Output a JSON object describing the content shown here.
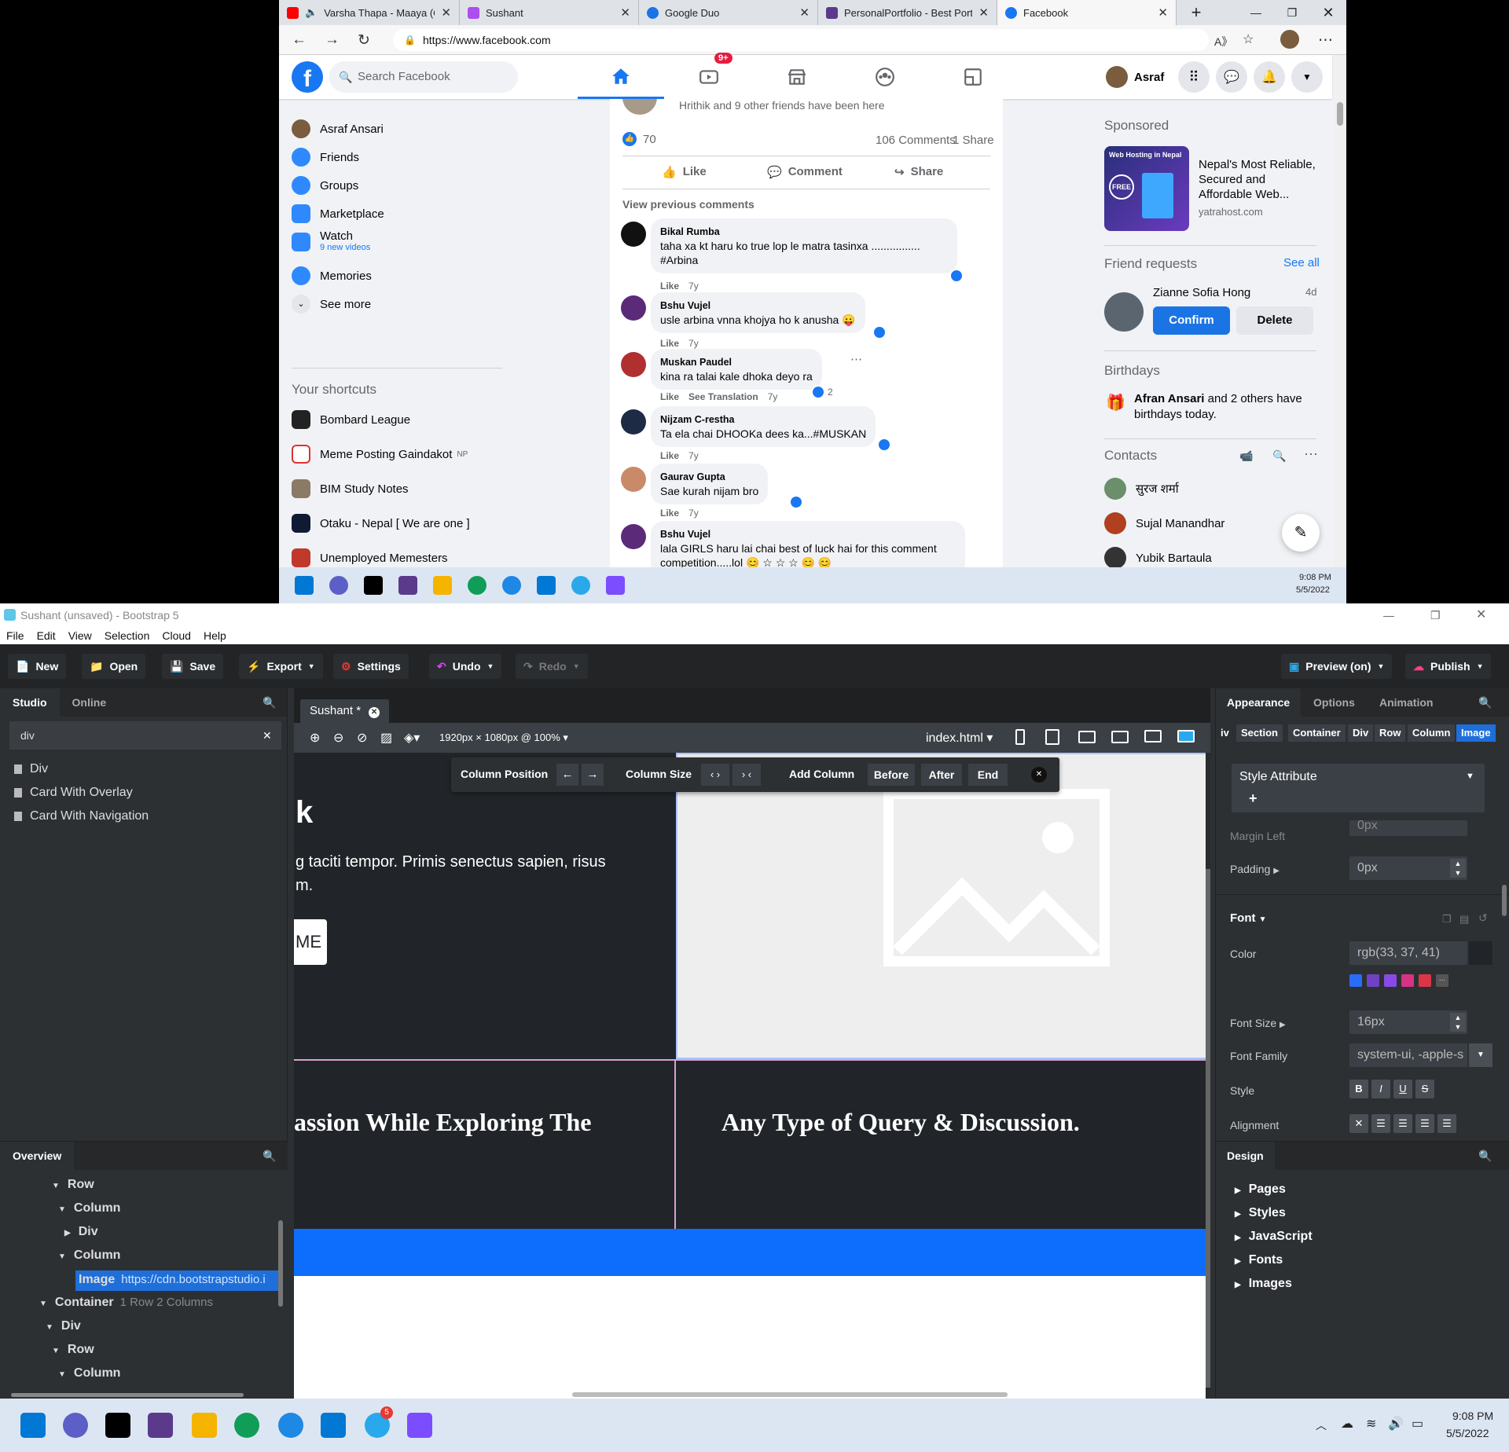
{
  "browser": {
    "tabs": [
      {
        "title": "Varsha Thapa - Maaya (O",
        "color": "#ff0000"
      },
      {
        "title": "Sushant",
        "color": "#ad4ef0"
      },
      {
        "title": "Google Duo",
        "color": "#1a73e8"
      },
      {
        "title": "PersonalPortfolio - Best Portfo",
        "color": "#5b3a8c"
      },
      {
        "title": "Facebook",
        "color": "#1877f2"
      }
    ],
    "url": "https://www.facebook.com",
    "taskbar_time": "9:08 PM",
    "taskbar_date": "5/5/2022"
  },
  "facebook": {
    "search_placeholder": "Search Facebook",
    "watch_badge": "9+",
    "user_name": "Asraf",
    "left_menu": [
      {
        "label": "Asraf Ansari",
        "color": "#7a5c3e"
      },
      {
        "label": "Friends",
        "color": "#2e89ff"
      },
      {
        "label": "Groups",
        "color": "#2e89ff"
      },
      {
        "label": "Marketplace",
        "color": "#2e89ff"
      },
      {
        "label": "Watch",
        "color": "#2e89ff"
      },
      {
        "label": "Memories",
        "color": "#2e89ff"
      },
      {
        "label": "See more",
        "color": "#e4e6eb"
      }
    ],
    "watch_sub": "9 new videos",
    "shortcuts_title": "Your shortcuts",
    "shortcuts": [
      {
        "label": "Bombard League",
        "suffix": "",
        "color": "#222"
      },
      {
        "label": "Meme Posting Gaindakot",
        "suffix": "NP",
        "color": "#d33"
      },
      {
        "label": "BIM Study Notes",
        "suffix": "",
        "color": "#8a7a66"
      },
      {
        "label": "Otaku - Nepal [ We are one ]",
        "suffix": "",
        "color": "#111a33"
      },
      {
        "label": "Unemployed Memesters",
        "suffix": "",
        "color": "#c0392b"
      }
    ],
    "post": {
      "friends_text": "Hrithik and 9 other friends have been here",
      "reactions": "70",
      "comments_count": "106 Comments",
      "shares": "1 Share",
      "actions": [
        "Like",
        "Comment",
        "Share"
      ],
      "view_previous": "View previous comments"
    },
    "comments": [
      {
        "name": "Bikal Rumba",
        "text": "taha xa kt haru ko true lop le matra tasinxa ................",
        "text2": "#Arbina",
        "like": "Like",
        "extra": "",
        "time": "7y",
        "count": "",
        "color": "#111"
      },
      {
        "name": "Bshu Vujel",
        "text": "usle arbina vnna khojya ho k anusha 😛",
        "text2": "",
        "like": "Like",
        "extra": "",
        "time": "7y",
        "count": "",
        "color": "#5b2b7a"
      },
      {
        "name": "Muskan Paudel",
        "text": "kina ra talai kale dhoka deyo ra",
        "text2": "",
        "like": "Like",
        "extra": "See Translation",
        "time": "7y",
        "count": "2",
        "color": "#b03030"
      },
      {
        "name": "Nijzam C-restha",
        "text": "Ta ela chai DHOOKa dees ka...#MUSKAN",
        "text2": "",
        "like": "Like",
        "extra": "",
        "time": "7y",
        "count": "",
        "color": "#1d2b44"
      },
      {
        "name": "Gaurav Gupta",
        "text": "Sae kurah nijam bro",
        "text2": "",
        "like": "Like",
        "extra": "",
        "time": "7y",
        "count": "",
        "color": "#c98a6a"
      },
      {
        "name": "Bshu Vujel",
        "text": "lala GIRLS haru lai chai best of luck hai for this comment",
        "text2": "competition.....lol 😊 ☆ ☆ ☆ 😊 😊",
        "like": "",
        "extra": "",
        "time": "",
        "count": "",
        "color": "#5b2b7a"
      }
    ],
    "sponsored_title": "Sponsored",
    "ad": {
      "title": "Nepal's Most Reliable, Secured and Affordable Web...",
      "domain": "yatrahost.com",
      "img_text": "Web Hosting in Nepal",
      "img_badge": "FREE"
    },
    "friend_requests_title": "Friend requests",
    "see_all": "See all",
    "request": {
      "name": "Zianne Sofia Hong",
      "age": "4d",
      "confirm": "Confirm",
      "delete": "Delete"
    },
    "birthdays_title": "Birthdays",
    "birthday_name": "Afran Ansari",
    "birthday_text": "and 2 others have birthdays today.",
    "contacts_title": "Contacts",
    "contacts": [
      {
        "name": "सुरज शर्मा",
        "color": "#6b8e6b"
      },
      {
        "name": "Sujal Manandhar",
        "color": "#b04020"
      },
      {
        "name": "Yubik Bartaula",
        "color": "#333"
      }
    ]
  },
  "bss": {
    "window_title": "Sushant (unsaved) - Bootstrap 5",
    "menu": [
      "File",
      "Edit",
      "View",
      "Selection",
      "Cloud",
      "Help"
    ],
    "toolbar": {
      "new": "New",
      "open": "Open",
      "save": "Save",
      "export": "Export",
      "settings": "Settings",
      "undo": "Undo",
      "redo": "Redo",
      "preview": "Preview (on)",
      "publish": "Publish"
    },
    "left_tabs": [
      "Studio",
      "Online"
    ],
    "search_value": "div",
    "components": [
      "Div",
      "Card With Overlay",
      "Card With Navigation"
    ],
    "overview_title": "Overview",
    "tree": [
      {
        "label": "Row",
        "sub": ""
      },
      {
        "label": "Column",
        "sub": ""
      },
      {
        "label": "Div",
        "sub": ""
      },
      {
        "label": "Column",
        "sub": ""
      },
      {
        "label": "Image",
        "sub": "https://cdn.bootstrapstudio.i"
      },
      {
        "label": "Container",
        "sub": "1 Row 2 Columns"
      },
      {
        "label": "Div",
        "sub": ""
      },
      {
        "label": "Row",
        "sub": ""
      },
      {
        "label": "Column",
        "sub": ""
      }
    ],
    "doc_tab": "Sushant *",
    "canvas_size": "1920px × 1080px @ 100%",
    "page_file": "index.html",
    "col_toolbar": {
      "position": "Column Position",
      "size": "Column Size",
      "add": "Add Column",
      "before": "Before",
      "after": "After",
      "end": "End"
    },
    "page": {
      "heading_frag": "k",
      "para_line1": "g taciti tempor. Primis senectus sapien, risus",
      "para_line2": "m.",
      "btn_frag": "ME",
      "heading2_frag": "assion While Exploring The",
      "heading3": "Any Type of Query & Discussion."
    },
    "right_tabs": [
      "Appearance",
      "Options",
      "Animation"
    ],
    "crumbs": [
      "iv",
      "Section",
      "Container",
      "Div",
      "Row",
      "Column",
      "Image"
    ],
    "style_attr": "Style Attribute",
    "margin_left_label": "Margin Left",
    "margin_left_value": "0px",
    "padding_label": "Padding",
    "padding_value": "0px",
    "font_label": "Font",
    "color_label": "Color",
    "color_value": "rgb(33, 37, 41)",
    "swatches": [
      "#2a6cf6",
      "#6f42c1",
      "#8a49e6",
      "#d63384",
      "#dc3545"
    ],
    "font_size_label": "Font Size",
    "font_size_value": "16px",
    "font_family_label": "Font Family",
    "font_family_value": "system-ui, -apple-s",
    "style_label": "Style",
    "alignment_label": "Alignment",
    "design_title": "Design",
    "design_items": [
      "Pages",
      "Styles",
      "JavaScript",
      "Fonts",
      "Images"
    ],
    "taskbar_time": "9:08 PM",
    "taskbar_date": "5/5/2022",
    "telegram_badge": "5"
  }
}
